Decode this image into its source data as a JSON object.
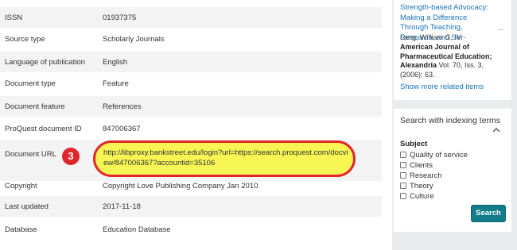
{
  "details": {
    "rows": [
      {
        "label": "ISSN",
        "value": "01937375"
      },
      {
        "label": "Source type",
        "value": "Scholarly Journals"
      },
      {
        "label": "Language of publication",
        "value": "English"
      },
      {
        "label": "Document type",
        "value": "Feature"
      },
      {
        "label": "Document feature",
        "value": "References"
      },
      {
        "label": "ProQuest document ID",
        "value": "847006367"
      },
      {
        "label": "Document URL",
        "value": "http://libproxy.bankstreet.edu/login?url=https://search.proquest.com/docview/847006367?accountid=35106"
      },
      {
        "label": "Copyright",
        "value": "Copyright Love Publishing Company Jan 2010"
      },
      {
        "label": "Last updated",
        "value": "2017-11-18"
      },
      {
        "label": "Database",
        "value": "Education Database"
      }
    ],
    "callout_number": "3",
    "colors": {
      "highlight": "#f7f553",
      "callout_red": "#e0262b"
    }
  },
  "related": {
    "title": "Strength-based Advocacy: Making a Difference Through Teaching, Research, and Ser-",
    "more": "...",
    "author": "Lang, William G, IV.",
    "journal": "American Journal of Pharmaceutical Education; Alexandria",
    "citation": " Vol. 70, Iss. 3, (2006): 63.",
    "show_more": "Show more related items"
  },
  "indexing": {
    "title": "Search with indexing terms",
    "subject_label": "Subject",
    "terms": [
      "Quality of service",
      "Clients",
      "Research",
      "Theory",
      "Culture"
    ],
    "search_button": "Search",
    "colors": {
      "button": "#127c8a",
      "link": "#1a73b8"
    }
  }
}
